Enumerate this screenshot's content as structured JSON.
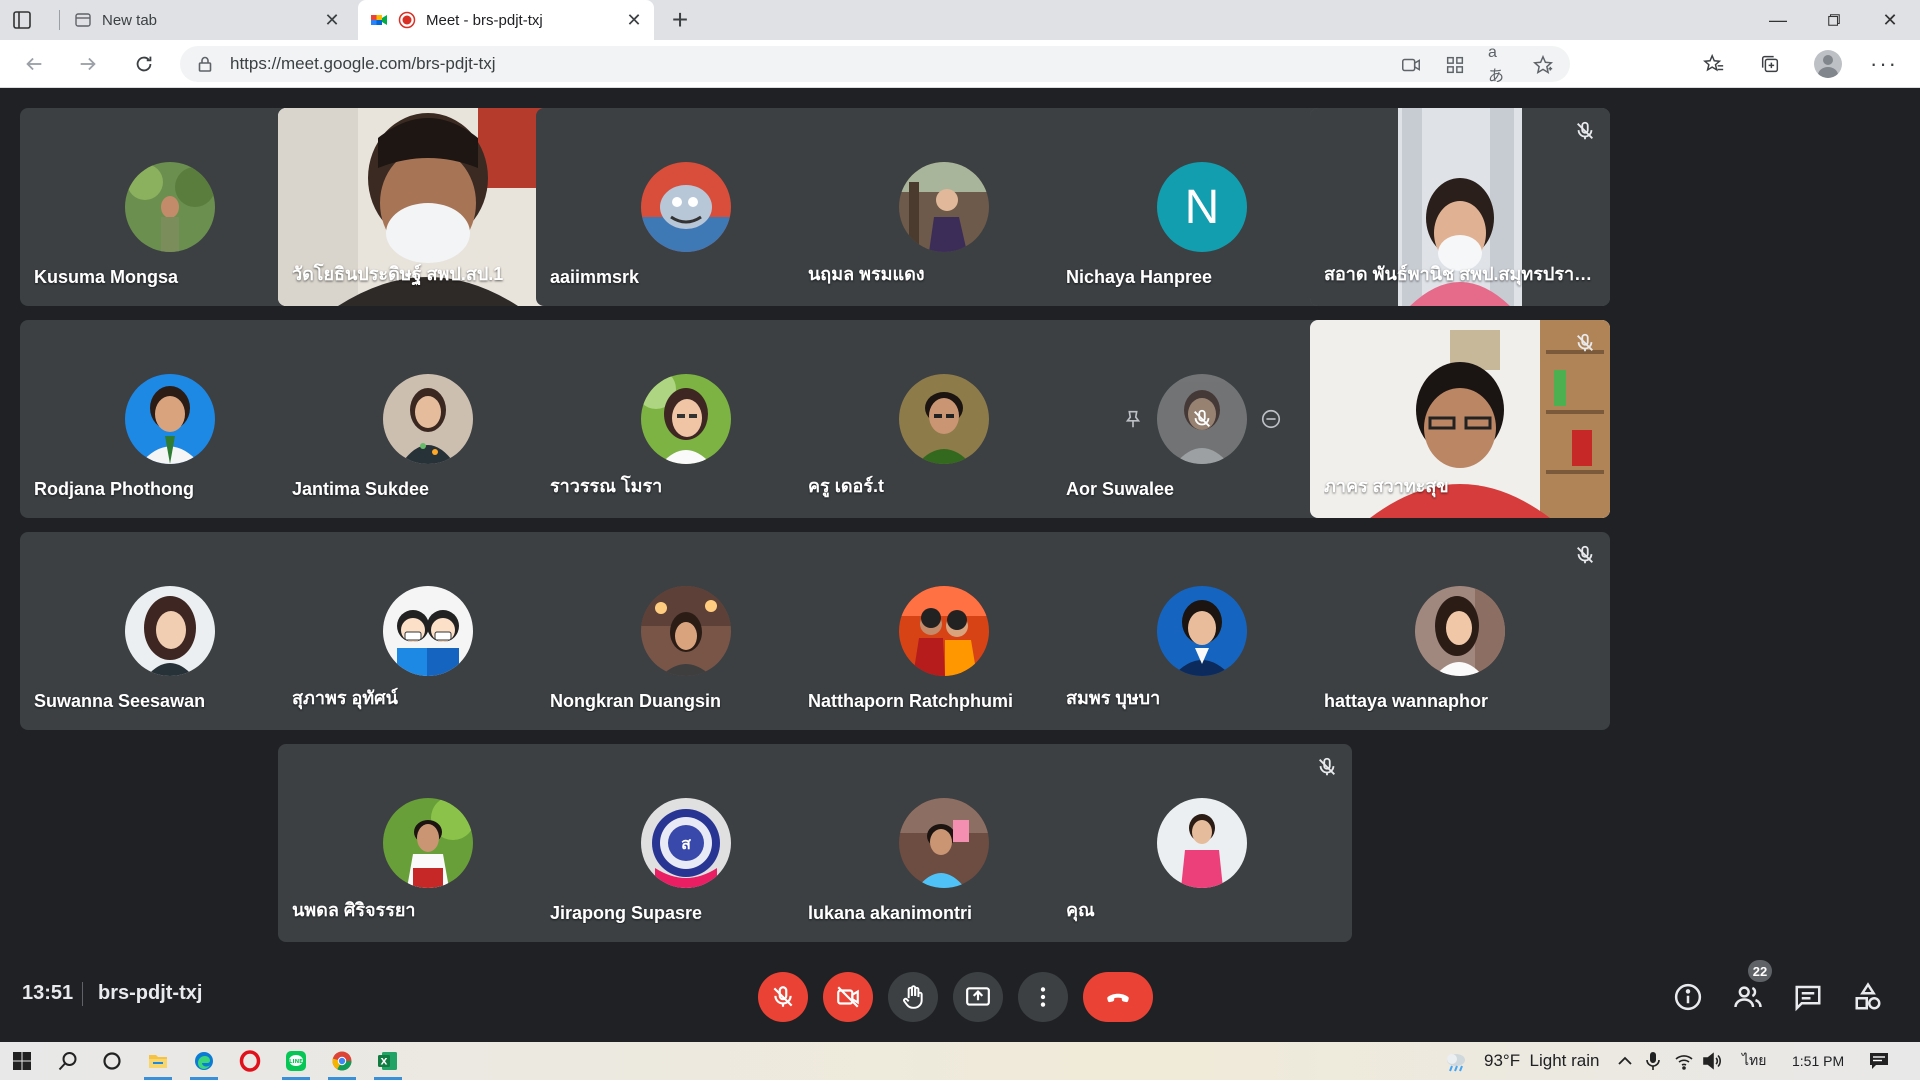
{
  "browser": {
    "tabs": [
      {
        "title": "New tab"
      },
      {
        "title": "Meet - brs-pdjt-txj",
        "recording": true
      }
    ],
    "url": "https://meet.google.com/brs-pdjt-txj"
  },
  "participants": [
    {
      "name": "Kusuma Mongsa",
      "kind": "photo",
      "color": "#6b8f4e"
    },
    {
      "name": "วัดโยธินประดิษฐ์ สพป.สป.1",
      "kind": "video",
      "selected": true
    },
    {
      "name": "aaiimmsrk",
      "kind": "photo",
      "color": "#4a7fb5"
    },
    {
      "name": "นฤมล พรมแดง",
      "kind": "photo",
      "color": "#6d5a4a"
    },
    {
      "name": "Nichaya Hanpree",
      "kind": "letter",
      "letter": "N",
      "color": "#129eaf"
    },
    {
      "name": "สอาด พันธ์พานิช สพป.สมุทรปราก...",
      "kind": "video"
    },
    {
      "name": "Rodjana Phothong",
      "kind": "photo",
      "color": "#1e88e5"
    },
    {
      "name": "Jantima Sukdee",
      "kind": "photo",
      "color": "#8d6e63"
    },
    {
      "name": "ราวรรณ โมรา",
      "kind": "photo",
      "color": "#7cb342"
    },
    {
      "name": "ครู เดอร์.t",
      "kind": "photo",
      "color": "#8d7b4a"
    },
    {
      "name": "Aor Suwalee",
      "kind": "photo",
      "color": "#9e9e9e",
      "hover": true
    },
    {
      "name": "ภาคร สวาทะสุข",
      "kind": "video"
    },
    {
      "name": "Suwanna Seesawan",
      "kind": "photo",
      "color": "#5d4037"
    },
    {
      "name": "สุภาพร อุทัศน์",
      "kind": "photo",
      "color": "#f5f5f5"
    },
    {
      "name": "Nongkran Duangsin",
      "kind": "photo",
      "color": "#795548"
    },
    {
      "name": "Natthaporn Ratchphumi",
      "kind": "photo",
      "color": "#d84315"
    },
    {
      "name": "สมพร บุษบา",
      "kind": "photo",
      "color": "#1565c0"
    },
    {
      "name": "hattaya wannaphor",
      "kind": "photo",
      "color": "#a1887f"
    },
    {
      "name": "นพดล ศิริจรรยา",
      "kind": "photo",
      "color": "#689f38"
    },
    {
      "name": "Jirapong Supasre",
      "kind": "photo",
      "color": "#3949ab"
    },
    {
      "name": "lukana akanimontri",
      "kind": "photo",
      "color": "#6d4c41"
    },
    {
      "name": "คุณ",
      "kind": "photo",
      "color": "#ec407a"
    }
  ],
  "meeting": {
    "time": "13:51",
    "code": "brs-pdjt-txj",
    "participant_count": "22"
  },
  "taskbar": {
    "weather": "93°F  Light rain",
    "language": "ไทย",
    "time": "1:51 PM"
  },
  "colors": {
    "meet_bg": "#202124",
    "tile_bg": "#3c4043",
    "danger": "#ea4335",
    "accent": "#1a73e8"
  }
}
